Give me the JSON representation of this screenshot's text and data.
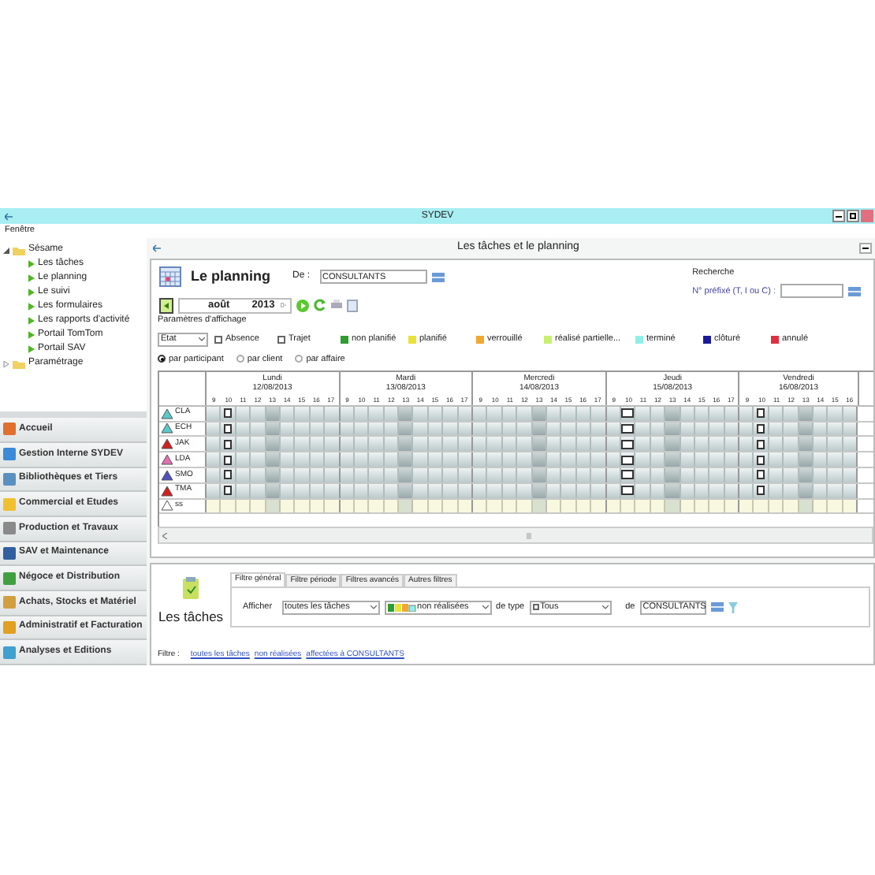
{
  "window": {
    "title": "SYDEV"
  },
  "menu": [
    "Fenêtre"
  ],
  "tree": [
    {
      "label": "Sésame",
      "kind": "folder",
      "expanded": true,
      "children": [
        {
          "label": "Les tâches",
          "kind": "page"
        },
        {
          "label": "Le planning",
          "kind": "page"
        },
        {
          "label": "Le suivi",
          "kind": "page"
        },
        {
          "label": "Les formulaires",
          "kind": "page"
        },
        {
          "label": "Les rapports d'activité",
          "kind": "page"
        },
        {
          "label": "Portail TomTom",
          "kind": "page"
        },
        {
          "label": "Portail SAV",
          "kind": "page"
        }
      ]
    },
    {
      "label": "Paramétrage",
      "kind": "folder",
      "expanded": false
    }
  ],
  "modules": [
    "Accueil",
    "Gestion Interne SYDEV",
    "Bibliothèques et Tiers",
    "Commercial et Etudes",
    "Production et Travaux",
    "SAV et Maintenance",
    "Négoce et Distribution",
    "Achats, Stocks et Matériel",
    "Administratif et Facturation",
    "Analyses et Editions"
  ],
  "panel_title": "Les tâches et le planning",
  "planning": {
    "title": "Le planning",
    "from_label": "De :",
    "from_value": "CONSULTANTS",
    "search_title": "Recherche",
    "search_label": "N° préfixé (T, I ou C) :",
    "month": "août",
    "year": "2013",
    "display_label": "Paramètres d'affichage",
    "state_select": "Etat",
    "options": [
      {
        "label": "Absence",
        "checked": false
      },
      {
        "label": "Trajet",
        "checked": false
      }
    ],
    "legend": [
      {
        "label": "non planifié",
        "color": "#2e9e2e"
      },
      {
        "label": "planifié",
        "color": "#e8e23a"
      },
      {
        "label": "verrouillé",
        "color": "#f0a830"
      },
      {
        "label": "réalisé partielle...",
        "color": "#c8f070"
      },
      {
        "label": "terminé",
        "color": "#90f0e8"
      },
      {
        "label": "clôturé",
        "color": "#1a1a9a"
      },
      {
        "label": "annulé",
        "color": "#e03040"
      }
    ],
    "views": [
      {
        "label": "par participant",
        "selected": true
      },
      {
        "label": "par client",
        "selected": false
      },
      {
        "label": "par affaire",
        "selected": false
      }
    ],
    "days": [
      {
        "name": "Lundi",
        "date": "12/08/2013",
        "hours": [
          {
            "label": "9",
            "kind": "slot"
          },
          {
            "label": "10",
            "kind": "small_task"
          },
          {
            "label": "11",
            "kind": "slot"
          },
          {
            "label": "12",
            "kind": "slot"
          },
          {
            "label": "13",
            "kind": "slot"
          },
          {
            "label": "14",
            "kind": "slot"
          },
          {
            "label": "15",
            "kind": "slot"
          },
          {
            "label": "16",
            "kind": "slot"
          },
          {
            "label": "17",
            "kind": "slot"
          }
        ]
      },
      {
        "name": "Mardi",
        "date": "13/08/2013",
        "hours": [
          {
            "label": "9",
            "kind": "slot"
          },
          {
            "label": "10",
            "kind": "slot"
          },
          {
            "label": "11",
            "kind": "slot"
          },
          {
            "label": "12",
            "kind": "slot"
          },
          {
            "label": "13",
            "kind": "slot"
          },
          {
            "label": "14",
            "kind": "slot"
          },
          {
            "label": "15",
            "kind": "slot"
          },
          {
            "label": "16",
            "kind": "slot"
          },
          {
            "label": "17",
            "kind": "slot"
          }
        ]
      },
      {
        "name": "Mercredi",
        "date": "14/08/2013",
        "hours": [
          {
            "label": "9",
            "kind": "slot"
          },
          {
            "label": "10",
            "kind": "slot"
          },
          {
            "label": "11",
            "kind": "slot"
          },
          {
            "label": "12",
            "kind": "slot"
          },
          {
            "label": "13",
            "kind": "slot"
          },
          {
            "label": "14",
            "kind": "slot"
          },
          {
            "label": "15",
            "kind": "slot"
          },
          {
            "label": "16",
            "kind": "slot"
          },
          {
            "label": "17",
            "kind": "slot"
          }
        ]
      },
      {
        "name": "Jeudi",
        "date": "15/08/2013",
        "hours": [
          {
            "label": "9",
            "kind": "slot"
          },
          {
            "label": "10",
            "kind": "wide_task"
          },
          {
            "label": "11",
            "kind": "slot"
          },
          {
            "label": "12",
            "kind": "slot"
          },
          {
            "label": "13",
            "kind": "slot"
          },
          {
            "label": "14",
            "kind": "slot"
          },
          {
            "label": "15",
            "kind": "slot"
          },
          {
            "label": "16",
            "kind": "slot"
          },
          {
            "label": "17",
            "kind": "slot"
          }
        ]
      },
      {
        "name": "Vendredi",
        "date": "16/08/2013",
        "hours": [
          {
            "label": "9",
            "kind": "slot"
          },
          {
            "label": "10",
            "kind": "small_task"
          },
          {
            "label": "11",
            "kind": "slot"
          },
          {
            "label": "12",
            "kind": "slot"
          },
          {
            "label": "13",
            "kind": "slot"
          },
          {
            "label": "14",
            "kind": "slot"
          },
          {
            "label": "15",
            "kind": "slot"
          },
          {
            "label": "16",
            "kind": "slot"
          }
        ]
      }
    ],
    "participants": [
      {
        "name": "CLA",
        "color": "#5cc8c8",
        "has_tasks": true
      },
      {
        "name": "ECH",
        "color": "#5cc8c8",
        "has_tasks": true
      },
      {
        "name": "JAK",
        "color": "#d02020",
        "has_tasks": true
      },
      {
        "name": "LDA",
        "color": "#e070b0",
        "has_tasks": true
      },
      {
        "name": "SMO",
        "color": "#5050c0",
        "has_tasks": true
      },
      {
        "name": "TMA",
        "color": "#d02020",
        "has_tasks": true
      },
      {
        "name": "ss",
        "color": "#ffffff",
        "has_tasks": false
      }
    ]
  },
  "tasks": {
    "title": "Les tâches",
    "tabs": [
      {
        "label": "Filtre général",
        "selected": true
      },
      {
        "label": "Filtre période",
        "selected": false
      },
      {
        "label": "Filtres avancés",
        "selected": false
      },
      {
        "label": "Autres filtres",
        "selected": false
      }
    ],
    "show_label": "Afficher",
    "show_value": "toutes les tâches",
    "status_value": "non réalisées",
    "type_label": "de type",
    "type_value": "Tous",
    "of_label": "de",
    "of_value": "CONSULTANTS",
    "filter_label": "Filtre :",
    "filter_links": [
      "toutes les tâches",
      "non réalisées",
      "affectées à CONSULTANTS"
    ]
  }
}
